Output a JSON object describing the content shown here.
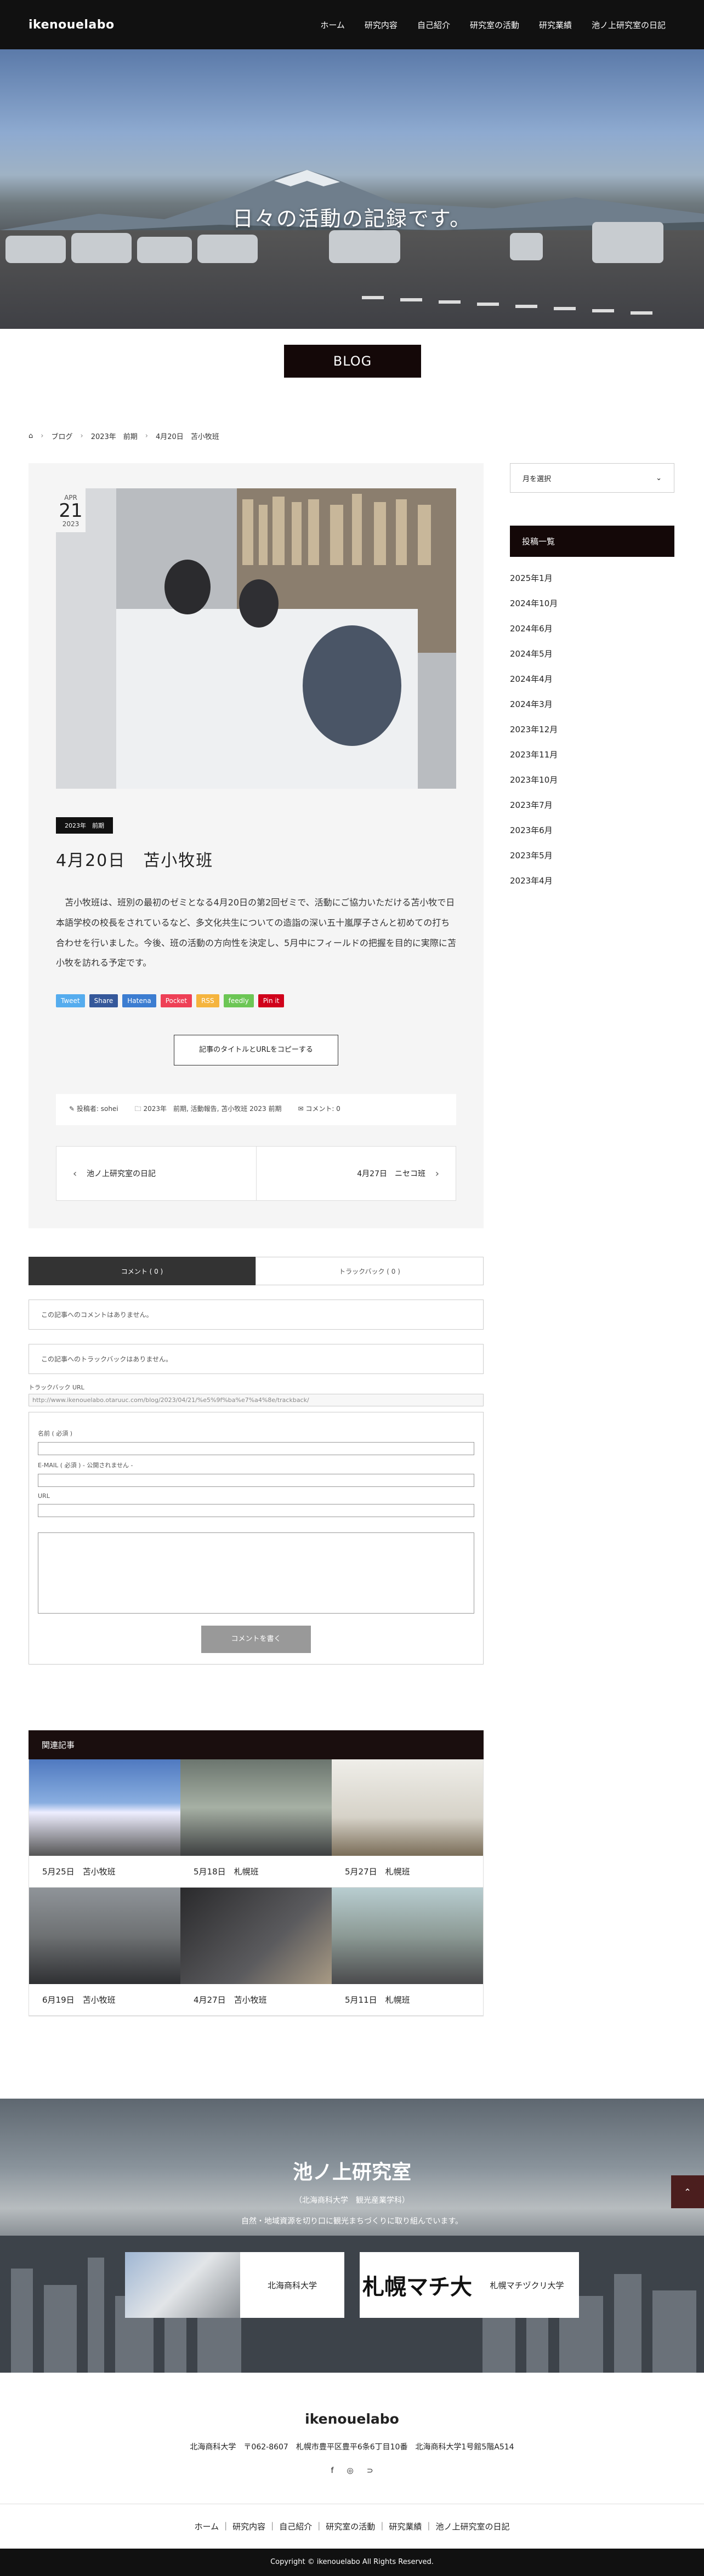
{
  "header": {
    "logo": "ikenouelabo",
    "nav": [
      "ホーム",
      "研究内容",
      "自己紹介",
      "研究室の活動",
      "研究業績",
      "池ノ上研究室の日記"
    ]
  },
  "hero": {
    "title": "日々の活動の記録です。",
    "label": "BLOG"
  },
  "breadcrumb": [
    "ブログ",
    "2023年　前期",
    "4月20日　苫小牧班"
  ],
  "post": {
    "date": {
      "month": "APR",
      "day": "21",
      "year": "2023"
    },
    "category": "2023年　前期",
    "title": "4月20日　苫小牧班",
    "body": "苫小牧班は、班別の最初のゼミとなる4月20日の第2回ゼミで、活動にご協力いただける苫小牧で日本語学校の校長をされているなど、多文化共生についての造詣の深い五十嵐厚子さんと初めての打ち合わせを行いました。今後、班の活動の方向性を決定し、5月中にフィールドの把握を目的に実際に苫小牧を訪れる予定です。",
    "share": [
      {
        "label": "Tweet",
        "color": "#55acee"
      },
      {
        "label": "Share",
        "color": "#35589a"
      },
      {
        "label": "Hatena",
        "color": "#3c7dd1"
      },
      {
        "label": "Pocket",
        "color": "#ee4056"
      },
      {
        "label": "RSS",
        "color": "#f5b43e"
      },
      {
        "label": "feedly",
        "color": "#6cc655"
      },
      {
        "label": "Pin it",
        "color": "#d0021b"
      }
    ],
    "copy_button": "記事のタイトルとURLをコピーする",
    "meta": {
      "author": "投稿者: sohei",
      "categories": "2023年　前期, 活動報告, 苫小牧班 2023 前期",
      "comments": "コメント: 0"
    },
    "prev": "池ノ上研究室の日記",
    "next": "4月27日　ニセコ班"
  },
  "comments": {
    "tab_comment": "コメント ( 0 )",
    "tab_trackback": "トラックバック ( 0 )",
    "no_comments": "この記事へのコメントはありません。",
    "no_trackbacks": "この記事へのトラックバックはありません。",
    "tb_label": "トラックバック URL",
    "tb_url": "http://www.ikenouelabo.otaruuc.com/blog/2023/04/21/%e5%9f%ba%e7%a4%8e/trackback/",
    "name_label": "名前 ( 必須 )",
    "email_label": "E-MAIL ( 必須 ) - 公開されません -",
    "url_label": "URL",
    "submit": "コメントを書く"
  },
  "related": {
    "heading": "関連記事",
    "items": [
      {
        "title": "5月25日　苫小牧班",
        "color": "#5b7db8"
      },
      {
        "title": "5月18日　札幌班",
        "color": "#7d8a7a"
      },
      {
        "title": "5月27日　札幌班",
        "color": "#d6d2c8"
      },
      {
        "title": "6月19日　苫小牧班",
        "color": "#6e7173"
      },
      {
        "title": "4月27日　苫小牧班",
        "color": "#4a4a4c"
      },
      {
        "title": "5月11日　札幌班",
        "color": "#8c9a95"
      }
    ]
  },
  "sidebar": {
    "select": "月を選択",
    "heading": "投稿一覧",
    "archives": [
      "2025年1月",
      "2024年10月",
      "2024年6月",
      "2024年5月",
      "2024年4月",
      "2024年3月",
      "2023年12月",
      "2023年11月",
      "2023年10月",
      "2023年7月",
      "2023年6月",
      "2023年5月",
      "2023年4月"
    ]
  },
  "banner": {
    "title": "池ノ上研究室",
    "sub": "（北海商科大学　観光産業学科）",
    "desc": "自然・地域資源を切り口に観光まちづくりに取り組んでいます。",
    "card1": "北海商科大学",
    "card2": "札幌マチヅクリ大学",
    "card2_logo": "札幌マチ大"
  },
  "footer": {
    "logo": "ikenouelabo",
    "address": "北海商科大学　〒062-8607　札幌市豊平区豊平6条6丁目10番　北海商科大学1号館5階A514",
    "nav": [
      "ホーム",
      "研究内容",
      "自己紹介",
      "研究室の活動",
      "研究業績",
      "池ノ上研究室の日記"
    ],
    "copyright": "Copyright © ikenouelabo All Rights Reserved."
  }
}
